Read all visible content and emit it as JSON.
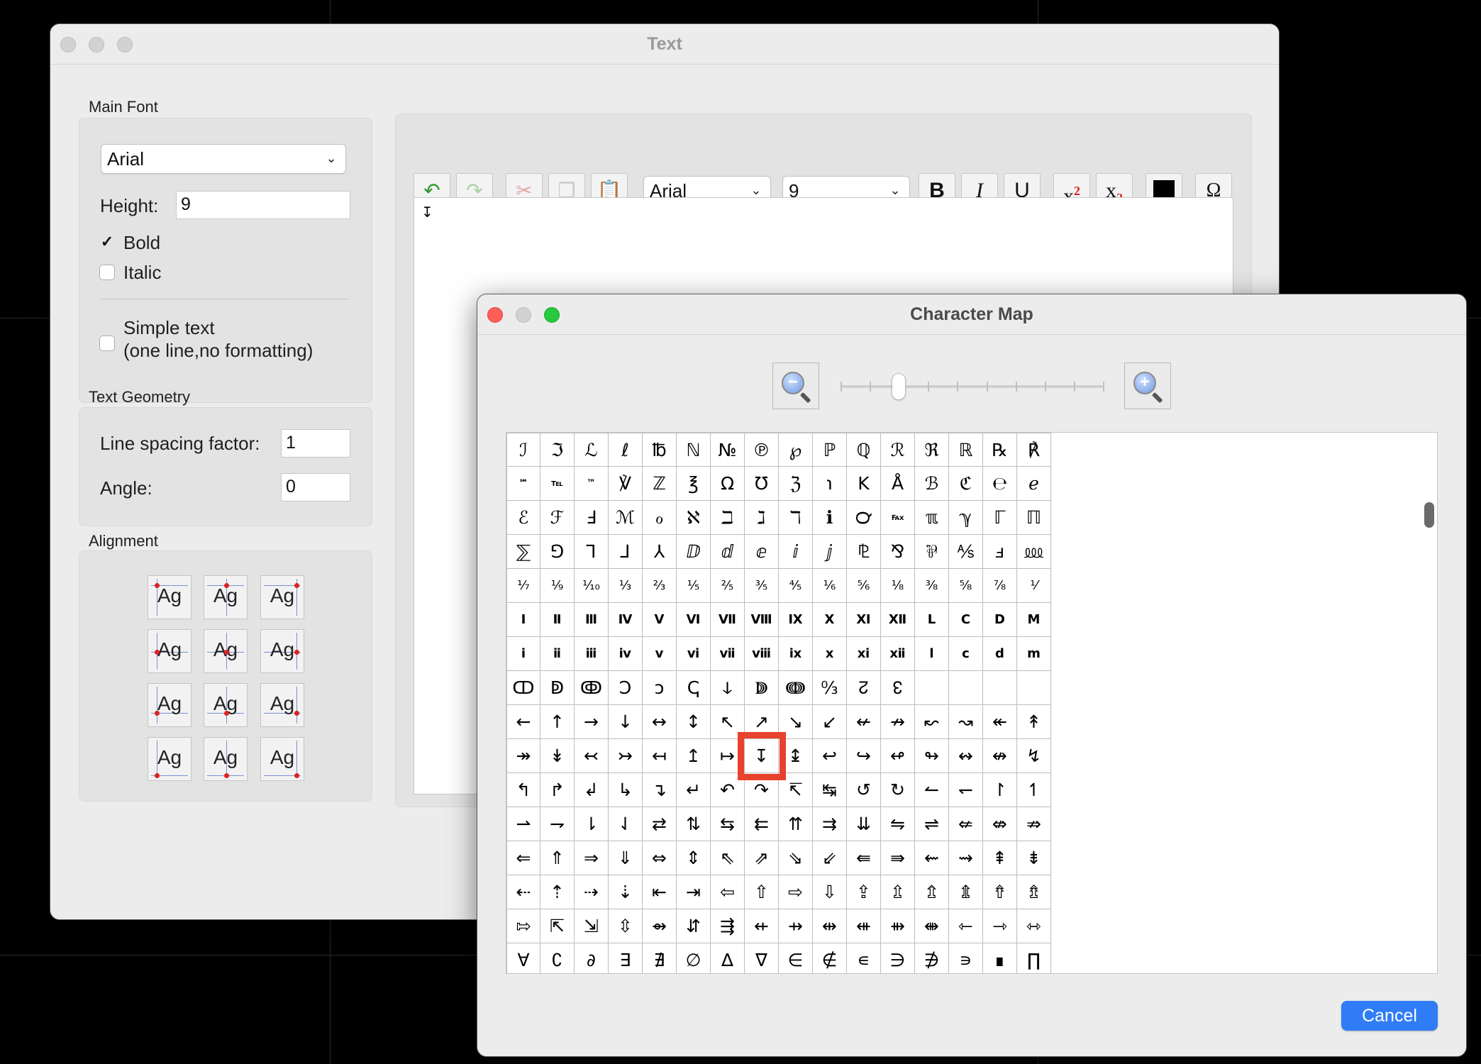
{
  "text_window": {
    "title": "Text",
    "main_font": {
      "label": "Main Font",
      "font_value": "Arial",
      "height_label": "Height:",
      "height_value": "9",
      "bold_label": "Bold",
      "italic_label": "Italic",
      "simple_text_label": "Simple text",
      "simple_text_sub": "(one line,no formatting)",
      "bold_checked": true,
      "italic_checked": false,
      "simple_checked": false
    },
    "geometry": {
      "label": "Text Geometry",
      "line_spacing_label": "Line spacing factor:",
      "line_spacing_value": "1",
      "angle_label": "Angle:",
      "angle_value": "0"
    },
    "alignment": {
      "label": "Alignment",
      "button_text": "Ag"
    },
    "toolbar": {
      "font_value": "Arial",
      "size_value": "9",
      "bold": "B",
      "italic": "I",
      "underline": "U",
      "superscript_base": "x",
      "superscript_mark": "2",
      "subscript_base": "x",
      "subscript_mark": "2",
      "omega": "Ω",
      "color": "#000000"
    },
    "editor_content": "↧"
  },
  "char_map": {
    "title": "Character Map",
    "cancel_label": "Cancel",
    "zoom_out": "−",
    "zoom_in": "+",
    "selected": {
      "row": 9,
      "col": 7
    },
    "rows": [
      [
        "ℐ",
        "ℑ",
        "ℒ",
        "ℓ",
        "℔",
        "ℕ",
        "№",
        "℗",
        "℘",
        "ℙ",
        "ℚ",
        "ℛ",
        "ℜ",
        "ℝ",
        "℞",
        "℟"
      ],
      [
        "℠",
        "℡",
        "™",
        "℣",
        "ℤ",
        "℥",
        "Ω",
        "℧",
        "ℨ",
        "℩",
        "K",
        "Å",
        "ℬ",
        "ℭ",
        "℮",
        "ℯ"
      ],
      [
        "ℰ",
        "ℱ",
        "Ⅎ",
        "ℳ",
        "ℴ",
        "ℵ",
        "ℶ",
        "ℷ",
        "ℸ",
        "ℹ",
        "℺",
        "℻",
        "ℼ",
        "ℽ",
        "ℾ",
        "ℿ"
      ],
      [
        "⅀",
        "⅁",
        "⅂",
        "⅃",
        "⅄",
        "ⅅ",
        "ⅆ",
        "ⅇ",
        "ⅈ",
        "ⅉ",
        "⅊",
        "⅋",
        "⅌",
        "⅍",
        "ⅎ",
        "⅏"
      ],
      [
        "⅐",
        "⅑",
        "⅒",
        "⅓",
        "⅔",
        "⅕",
        "⅖",
        "⅗",
        "⅘",
        "⅙",
        "⅚",
        "⅛",
        "⅜",
        "⅝",
        "⅞",
        "⅟"
      ],
      [
        "Ⅰ",
        "Ⅱ",
        "Ⅲ",
        "Ⅳ",
        "Ⅴ",
        "Ⅵ",
        "Ⅶ",
        "Ⅷ",
        "Ⅸ",
        "Ⅹ",
        "Ⅺ",
        "Ⅻ",
        "Ⅼ",
        "Ⅽ",
        "Ⅾ",
        "Ⅿ"
      ],
      [
        "ⅰ",
        "ⅱ",
        "ⅲ",
        "ⅳ",
        "ⅴ",
        "ⅵ",
        "ⅶ",
        "ⅷ",
        "ⅸ",
        "ⅹ",
        "ⅺ",
        "ⅻ",
        "ⅼ",
        "ⅽ",
        "ⅾ",
        "ⅿ"
      ],
      [
        "ↀ",
        "ↁ",
        "ↂ",
        "Ↄ",
        "ↄ",
        "ↅ",
        "ↆ",
        "ↇ",
        "ↈ",
        "↉",
        "↊",
        "↋",
        "↌",
        "↍",
        "↎",
        "↏"
      ],
      [
        "←",
        "↑",
        "→",
        "↓",
        "↔",
        "↕",
        "↖",
        "↗",
        "↘",
        "↙",
        "↚",
        "↛",
        "↜",
        "↝",
        "↞",
        "↟"
      ],
      [
        "↠",
        "↡",
        "↢",
        "↣",
        "↤",
        "↥",
        "↦",
        "↧",
        "↨",
        "↩",
        "↪",
        "↫",
        "↬",
        "↭",
        "↮",
        "↯"
      ],
      [
        "↰",
        "↱",
        "↲",
        "↳",
        "↴",
        "↵",
        "↶",
        "↷",
        "↸",
        "↹",
        "↺",
        "↻",
        "↼",
        "↽",
        "↾",
        "↿"
      ],
      [
        "⇀",
        "⇁",
        "⇂",
        "⇃",
        "⇄",
        "⇅",
        "⇆",
        "⇇",
        "⇈",
        "⇉",
        "⇊",
        "⇋",
        "⇌",
        "⇍",
        "⇎",
        "⇏"
      ],
      [
        "⇐",
        "⇑",
        "⇒",
        "⇓",
        "⇔",
        "⇕",
        "⇖",
        "⇗",
        "⇘",
        "⇙",
        "⇚",
        "⇛",
        "⇜",
        "⇝",
        "⇞",
        "⇟"
      ],
      [
        "⇠",
        "⇡",
        "⇢",
        "⇣",
        "⇤",
        "⇥",
        "⇦",
        "⇧",
        "⇨",
        "⇩",
        "⇪",
        "⇫",
        "⇬",
        "⇭",
        "⇮",
        "⇯"
      ],
      [
        "⇰",
        "⇱",
        "⇲",
        "⇳",
        "⇴",
        "⇵",
        "⇶",
        "⇷",
        "⇸",
        "⇹",
        "⇺",
        "⇻",
        "⇼",
        "⇽",
        "⇾",
        "⇿"
      ],
      [
        "∀",
        "∁",
        "∂",
        "∃",
        "∄",
        "∅",
        "∆",
        "∇",
        "∈",
        "∉",
        "∊",
        "∋",
        "∌",
        "∍",
        "∎",
        "∏"
      ]
    ]
  }
}
